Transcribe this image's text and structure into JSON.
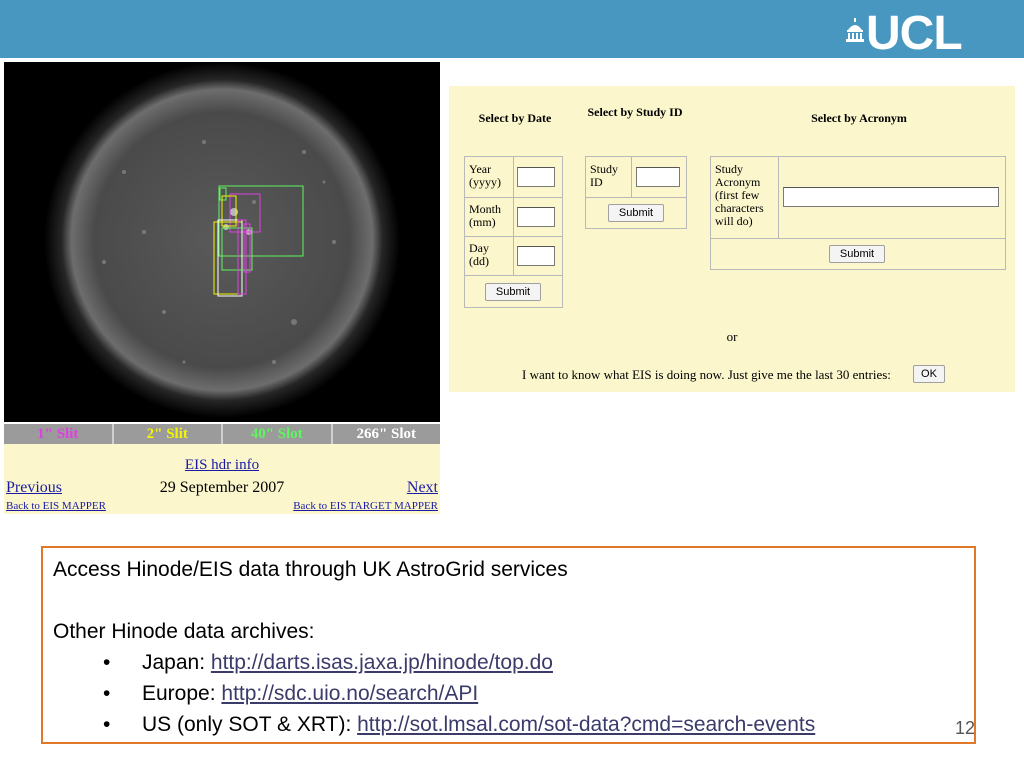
{
  "header": {
    "logo_text": "UCL",
    "bar_color": "#4797c0"
  },
  "sun_viewer": {
    "slots": [
      {
        "label": "1\" Slit",
        "color": "#e040e0"
      },
      {
        "label": "2\" Slit",
        "color": "#f5f500"
      },
      {
        "label": "40\" Slot",
        "color": "#5ef55e"
      },
      {
        "label": "266\" Slot",
        "color": "#ffffff"
      }
    ],
    "hdr_link": "EIS hdr info",
    "previous": "Previous",
    "date": "29 September 2007",
    "next": "Next",
    "back_mapper": "Back to EIS MAPPER",
    "back_target": "Back to EIS TARGET MAPPER"
  },
  "search_form": {
    "by_date": {
      "heading": "Select by Date",
      "year_label": "Year (yyyy)",
      "month_label": "Month (mm)",
      "day_label": "Day (dd)",
      "submit": "Submit"
    },
    "by_study": {
      "heading": "Select by Study ID",
      "id_label": "Study ID",
      "submit": "Submit"
    },
    "by_acronym": {
      "heading": "Select by Acronym",
      "acronym_label": "Study Acronym (first few characters will do)",
      "submit": "Submit"
    },
    "or_text": "or",
    "last_entries_text": "I want to know what EIS is doing now. Just give me the last 30 entries:",
    "ok_button": "OK"
  },
  "info": {
    "line1": "Access Hinode/EIS data through UK AstroGrid services",
    "line2": "Other Hinode data archives:",
    "archives": [
      {
        "label": "Japan: ",
        "url": "http://darts.isas.jaxa.jp/hinode/top.do"
      },
      {
        "label": "Europe: ",
        "url": "http://sdc.uio.no/search/API"
      },
      {
        "label": "US (only SOT & XRT): ",
        "url": "http://sot.lmsal.com/sot-data?cmd=search-events"
      }
    ],
    "bullet": "•",
    "accent": "#e0782c"
  },
  "page_number": "12"
}
